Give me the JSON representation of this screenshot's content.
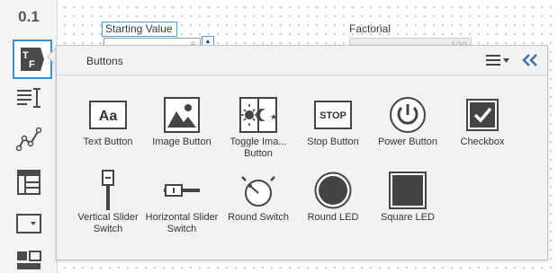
{
  "toolbar": {
    "value_label": "0.1",
    "items": [
      {
        "icon": "value-icon"
      },
      {
        "icon": "text-format-icon"
      },
      {
        "icon": "text-list-icon"
      },
      {
        "icon": "chart-icon"
      },
      {
        "icon": "table-icon"
      },
      {
        "icon": "dropdown-icon"
      },
      {
        "icon": "layout-icon"
      }
    ]
  },
  "canvas": {
    "starting_value_label": "Starting Value",
    "factorial_label": "Factorial",
    "starting_value": "5",
    "factorial_value": "120"
  },
  "panel": {
    "title": "Buttons",
    "widgets": [
      {
        "label": "Text Button",
        "icon": "text-button-icon",
        "glyph": "Aa"
      },
      {
        "label": "Image Button",
        "icon": "image-button-icon"
      },
      {
        "label": "Toggle Ima... Button",
        "icon": "toggle-image-button-icon"
      },
      {
        "label": "Stop Button",
        "icon": "stop-button-icon",
        "glyph": "STOP"
      },
      {
        "label": "Power Button",
        "icon": "power-button-icon"
      },
      {
        "label": "Checkbox",
        "icon": "checkbox-icon"
      },
      {
        "label": "Vertical Slider Switch",
        "icon": "vertical-slider-switch-icon"
      },
      {
        "label": "Horizontal Slider Switch",
        "icon": "horizontal-slider-switch-icon"
      },
      {
        "label": "Round Switch",
        "icon": "round-switch-icon"
      },
      {
        "label": "Round LED",
        "icon": "round-led-icon"
      },
      {
        "label": "Square LED",
        "icon": "square-led-icon"
      }
    ]
  },
  "colors": {
    "accent": "#3d8fd6",
    "icon_dark": "#444444",
    "panel_bg": "#f2f2f2",
    "collapse": "#3a6fa8"
  }
}
